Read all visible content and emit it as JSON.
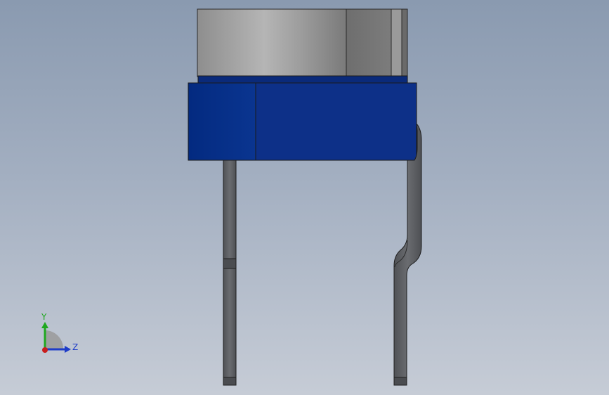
{
  "viewport": {
    "background_top": "#8a9ab0",
    "background_bottom": "#c6ccd6"
  },
  "model": {
    "cap_color": "#a8a8a8",
    "base_color": "#0d3088",
    "lead_color": "#5e6064"
  },
  "triad": {
    "y_label": "Y",
    "z_label": "Z",
    "y_color": "#1fa81f",
    "z_color": "#1e3cc8",
    "x_color": "#c81e1e"
  }
}
